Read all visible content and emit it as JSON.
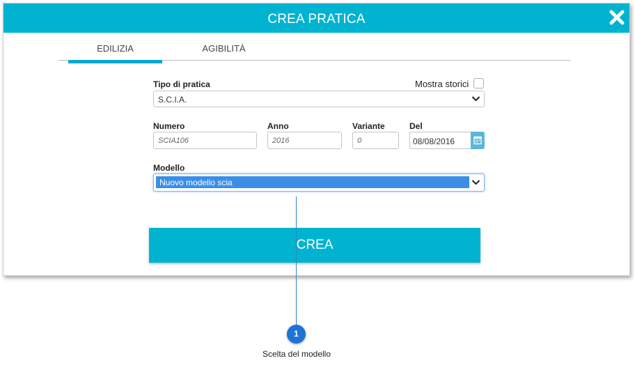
{
  "header": {
    "title": "CREA PRATICA"
  },
  "tabs": [
    {
      "label": "EDILIZIA",
      "active": true
    },
    {
      "label": "AGIBILITÀ",
      "active": false
    }
  ],
  "form": {
    "tipo_label": "Tipo di pratica",
    "tipo_value": "S.C.I.A.",
    "mostra_storici_label": "Mostra storici",
    "mostra_storici_checked": false,
    "numero_label": "Numero",
    "numero_placeholder": "SCIA106",
    "anno_label": "Anno",
    "anno_placeholder": "2016",
    "variante_label": "Variante",
    "variante_placeholder": "0",
    "del_label": "Del",
    "del_value": "08/08/2016",
    "modello_label": "Modello",
    "modello_value": "Nuovo modello scia"
  },
  "actions": {
    "crea_label": "CREA"
  },
  "callout": {
    "number": "1",
    "caption": "Scelta del modello"
  },
  "colors": {
    "accent": "#00b3d0",
    "tab_underline": "#00a9d4",
    "callout": "#1e73d6",
    "selection": "#3a8ee6"
  },
  "icons": {
    "close": "close-icon",
    "chevron": "chevron-down-icon",
    "calendar": "calendar-icon"
  }
}
